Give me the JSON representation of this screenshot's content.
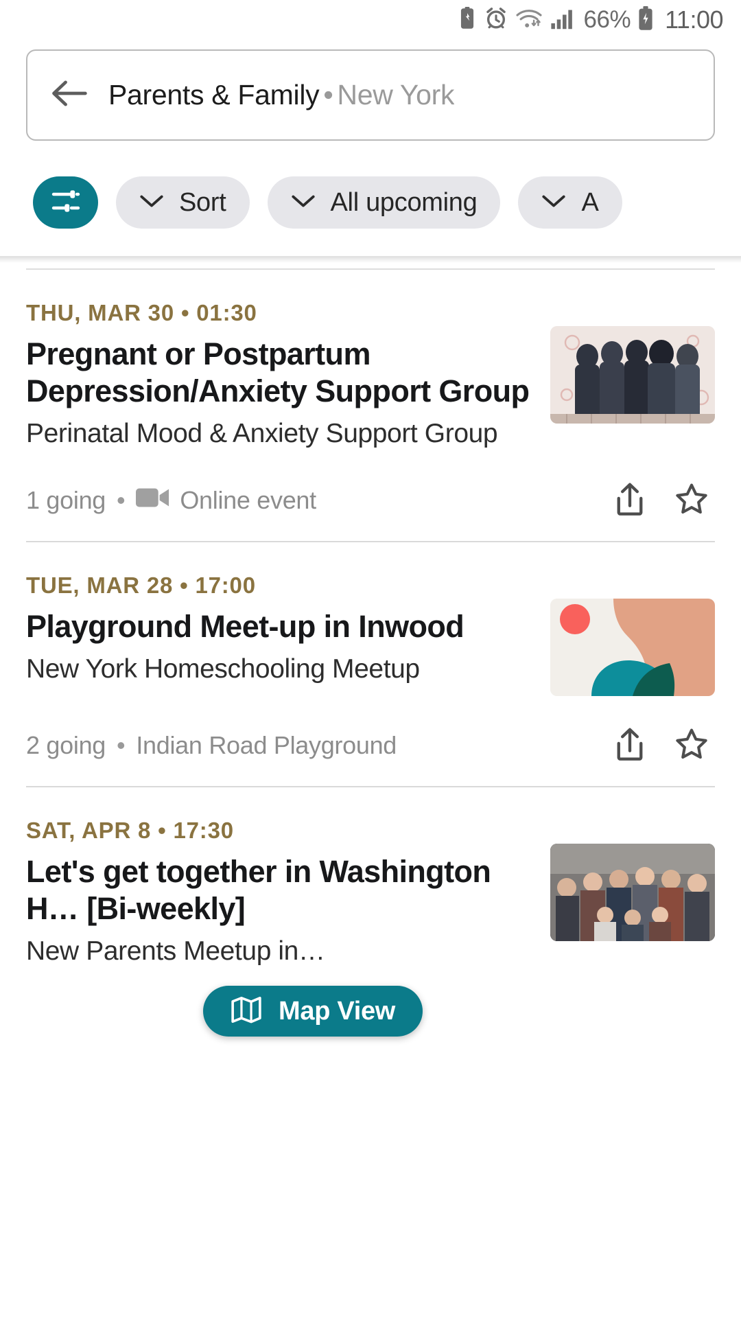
{
  "statusbar": {
    "icons": [
      "battery-saver-icon",
      "alarm-icon",
      "wifi-icon",
      "signal-icon"
    ],
    "battery_percent": "66%",
    "battery_icon": "charging-battery-icon",
    "time": "11:00"
  },
  "search": {
    "back_icon": "back-arrow-icon",
    "query": "Parents & Family",
    "separator": "•",
    "location": "New York"
  },
  "filters": {
    "filter_icon": "sliders-icon",
    "chips": [
      {
        "label": "Sort",
        "icon": "chevron-down-icon"
      },
      {
        "label": "All upcoming",
        "icon": "chevron-down-icon"
      },
      {
        "label": "A",
        "icon": "chevron-down-icon"
      }
    ]
  },
  "events": [
    {
      "date": "THU, MAR 30 • 01:30",
      "title": "Pregnant or Postpartum Depression/Anxiety Support Group",
      "group": "Perinatal Mood & Anxiety Support Group",
      "attendees": "1 going",
      "dot": "•",
      "venue_icon": "video-camera-icon",
      "venue": "Online event",
      "share_icon": "share-icon",
      "save_icon": "star-outline-icon",
      "thumb": "support-group-photo"
    },
    {
      "date": "TUE, MAR 28 • 17:00",
      "title": "Playground Meet-up in Inwood",
      "group": "New York Homeschooling Meetup",
      "attendees": "2 going",
      "dot": "•",
      "venue_icon": "",
      "venue": "Indian Road Playground",
      "share_icon": "share-icon",
      "save_icon": "star-outline-icon",
      "thumb": "abstract-shapes-graphic"
    },
    {
      "date": "SAT, APR 8 • 17:30",
      "title": "Let's get together in Washington H… [Bi-weekly]",
      "group": "New Parents Meetup in…",
      "attendees": "",
      "dot": "",
      "venue_icon": "",
      "venue": "",
      "share_icon": "share-icon",
      "save_icon": "star-outline-icon",
      "thumb": "group-photo"
    }
  ],
  "map_view": {
    "icon": "map-icon",
    "label": "Map View"
  },
  "colors": {
    "accent_teal": "#0b7b8a",
    "date_gold": "#8a7340",
    "chip_bg": "#e6e6ea"
  }
}
